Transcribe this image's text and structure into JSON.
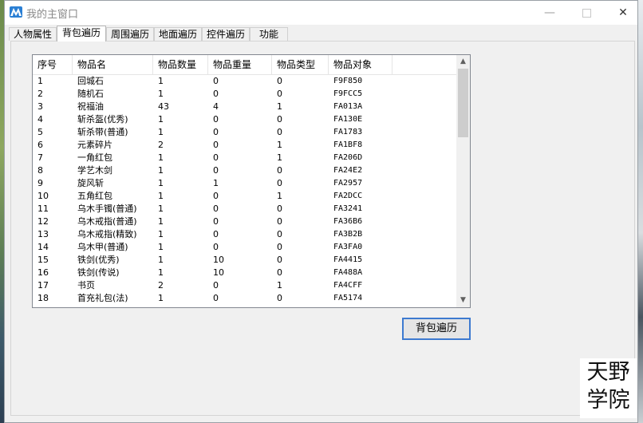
{
  "window": {
    "title": "我的主窗口",
    "controls": {
      "minimize": "—",
      "close": "✕"
    }
  },
  "tabs": [
    {
      "label": "人物属性",
      "active": false
    },
    {
      "label": "背包遍历",
      "active": true
    },
    {
      "label": "周围遍历",
      "active": false
    },
    {
      "label": "地面遍历",
      "active": false
    },
    {
      "label": "控件遍历",
      "active": false
    },
    {
      "label": "功能",
      "active": false
    }
  ],
  "inventory": {
    "columns": [
      "序号",
      "物品名",
      "物品数量",
      "物品重量",
      "物品类型",
      "物品对象"
    ],
    "rows": [
      [
        "1",
        "回城石",
        "1",
        "0",
        "0",
        "F9F850"
      ],
      [
        "2",
        "随机石",
        "1",
        "0",
        "0",
        "F9FCC5"
      ],
      [
        "3",
        "祝福油",
        "43",
        "4",
        "1",
        "FA013A"
      ],
      [
        "4",
        "斩杀盔(优秀)",
        "1",
        "0",
        "0",
        "FA130E"
      ],
      [
        "5",
        "斩杀带(普通)",
        "1",
        "0",
        "0",
        "FA1783"
      ],
      [
        "6",
        "元素碎片",
        "2",
        "0",
        "1",
        "FA1BF8"
      ],
      [
        "7",
        "一角红包",
        "1",
        "0",
        "1",
        "FA206D"
      ],
      [
        "8",
        "学艺木剑",
        "1",
        "0",
        "0",
        "FA24E2"
      ],
      [
        "9",
        "旋风斩",
        "1",
        "1",
        "0",
        "FA2957"
      ],
      [
        "10",
        "五角红包",
        "1",
        "0",
        "1",
        "FA2DCC"
      ],
      [
        "11",
        "乌木手镯(普通)",
        "1",
        "0",
        "0",
        "FA3241"
      ],
      [
        "12",
        "乌木戒指(普通)",
        "1",
        "0",
        "0",
        "FA36B6"
      ],
      [
        "13",
        "乌木戒指(精致)",
        "1",
        "0",
        "0",
        "FA3B2B"
      ],
      [
        "14",
        "乌木甲(普通)",
        "1",
        "0",
        "0",
        "FA3FA0"
      ],
      [
        "15",
        "铁剑(优秀)",
        "1",
        "10",
        "0",
        "FA4415"
      ],
      [
        "16",
        "铁剑(传说)",
        "1",
        "10",
        "0",
        "FA488A"
      ],
      [
        "17",
        "书页",
        "2",
        "0",
        "1",
        "FA4CFF"
      ],
      [
        "18",
        "首充礼包(法)",
        "1",
        "0",
        "0",
        "FA5174"
      ]
    ]
  },
  "buttons": {
    "traverse": "背包遍历"
  },
  "watermark": {
    "line1": "天野",
    "line2": "学院"
  },
  "scrollbar": {
    "up": "▲",
    "down": "▼"
  },
  "colors": {
    "accent": "#3d7ad0",
    "app_icon": "#2a7fd4"
  }
}
